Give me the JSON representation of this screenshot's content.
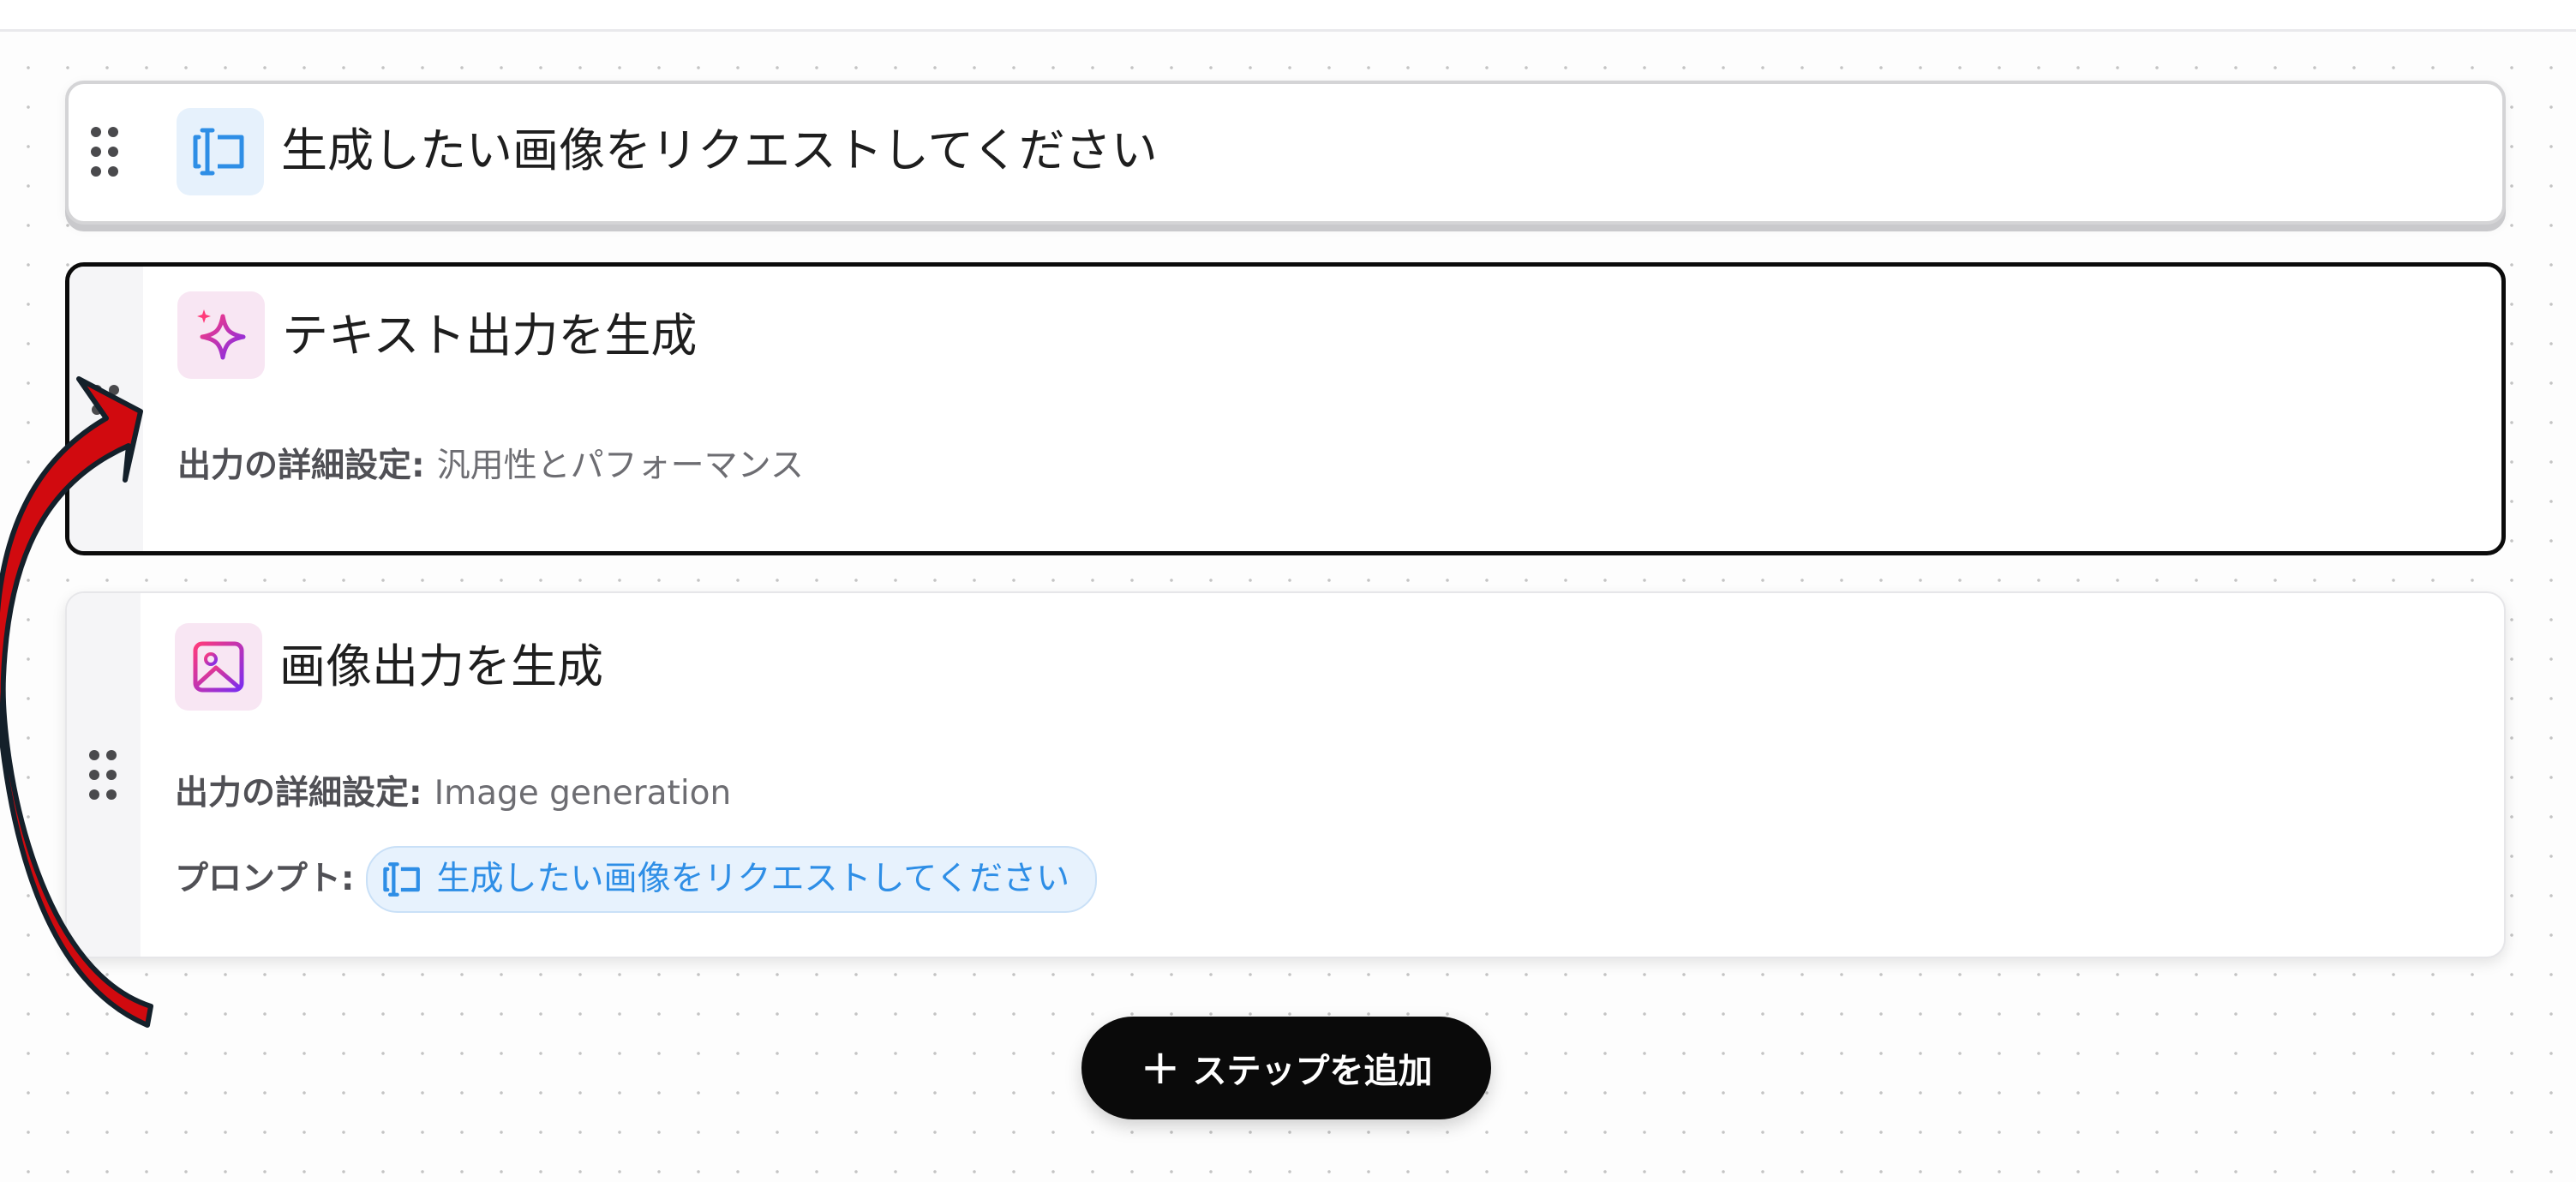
{
  "steps": [
    {
      "id": "request",
      "title": "生成したい画像をリクエストしてください",
      "icon": "text-input-icon",
      "icon_color": "#2e8ee6"
    },
    {
      "id": "text-generation",
      "title": "テキスト出力を生成",
      "icon": "sparkle-icon",
      "details_label": "出力の詳細設定",
      "details_separator": ":",
      "details_value": "汎用性とパフォーマンス",
      "selected": true
    },
    {
      "id": "image-generation",
      "title": "画像出力を生成",
      "icon": "image-icon",
      "details_label": "出力の詳細設定",
      "details_separator": ":",
      "details_value": "Image generation",
      "prompt_label": "プロンプト",
      "prompt_separator": ":",
      "prompt_chip": "生成したい画像をリクエストしてください"
    }
  ],
  "add_step": {
    "icon": "plus-icon",
    "label": "ステップを追加"
  },
  "annotation": {
    "icon": "curved-red-arrow-icon",
    "color": "#d10a0f",
    "outline": "#14202a"
  },
  "colors": {
    "accent_blue": "#2e8ee6",
    "selected_border": "#0b0b0b",
    "gradient_start": "#ff3b7a",
    "gradient_end": "#7a2cf0"
  }
}
